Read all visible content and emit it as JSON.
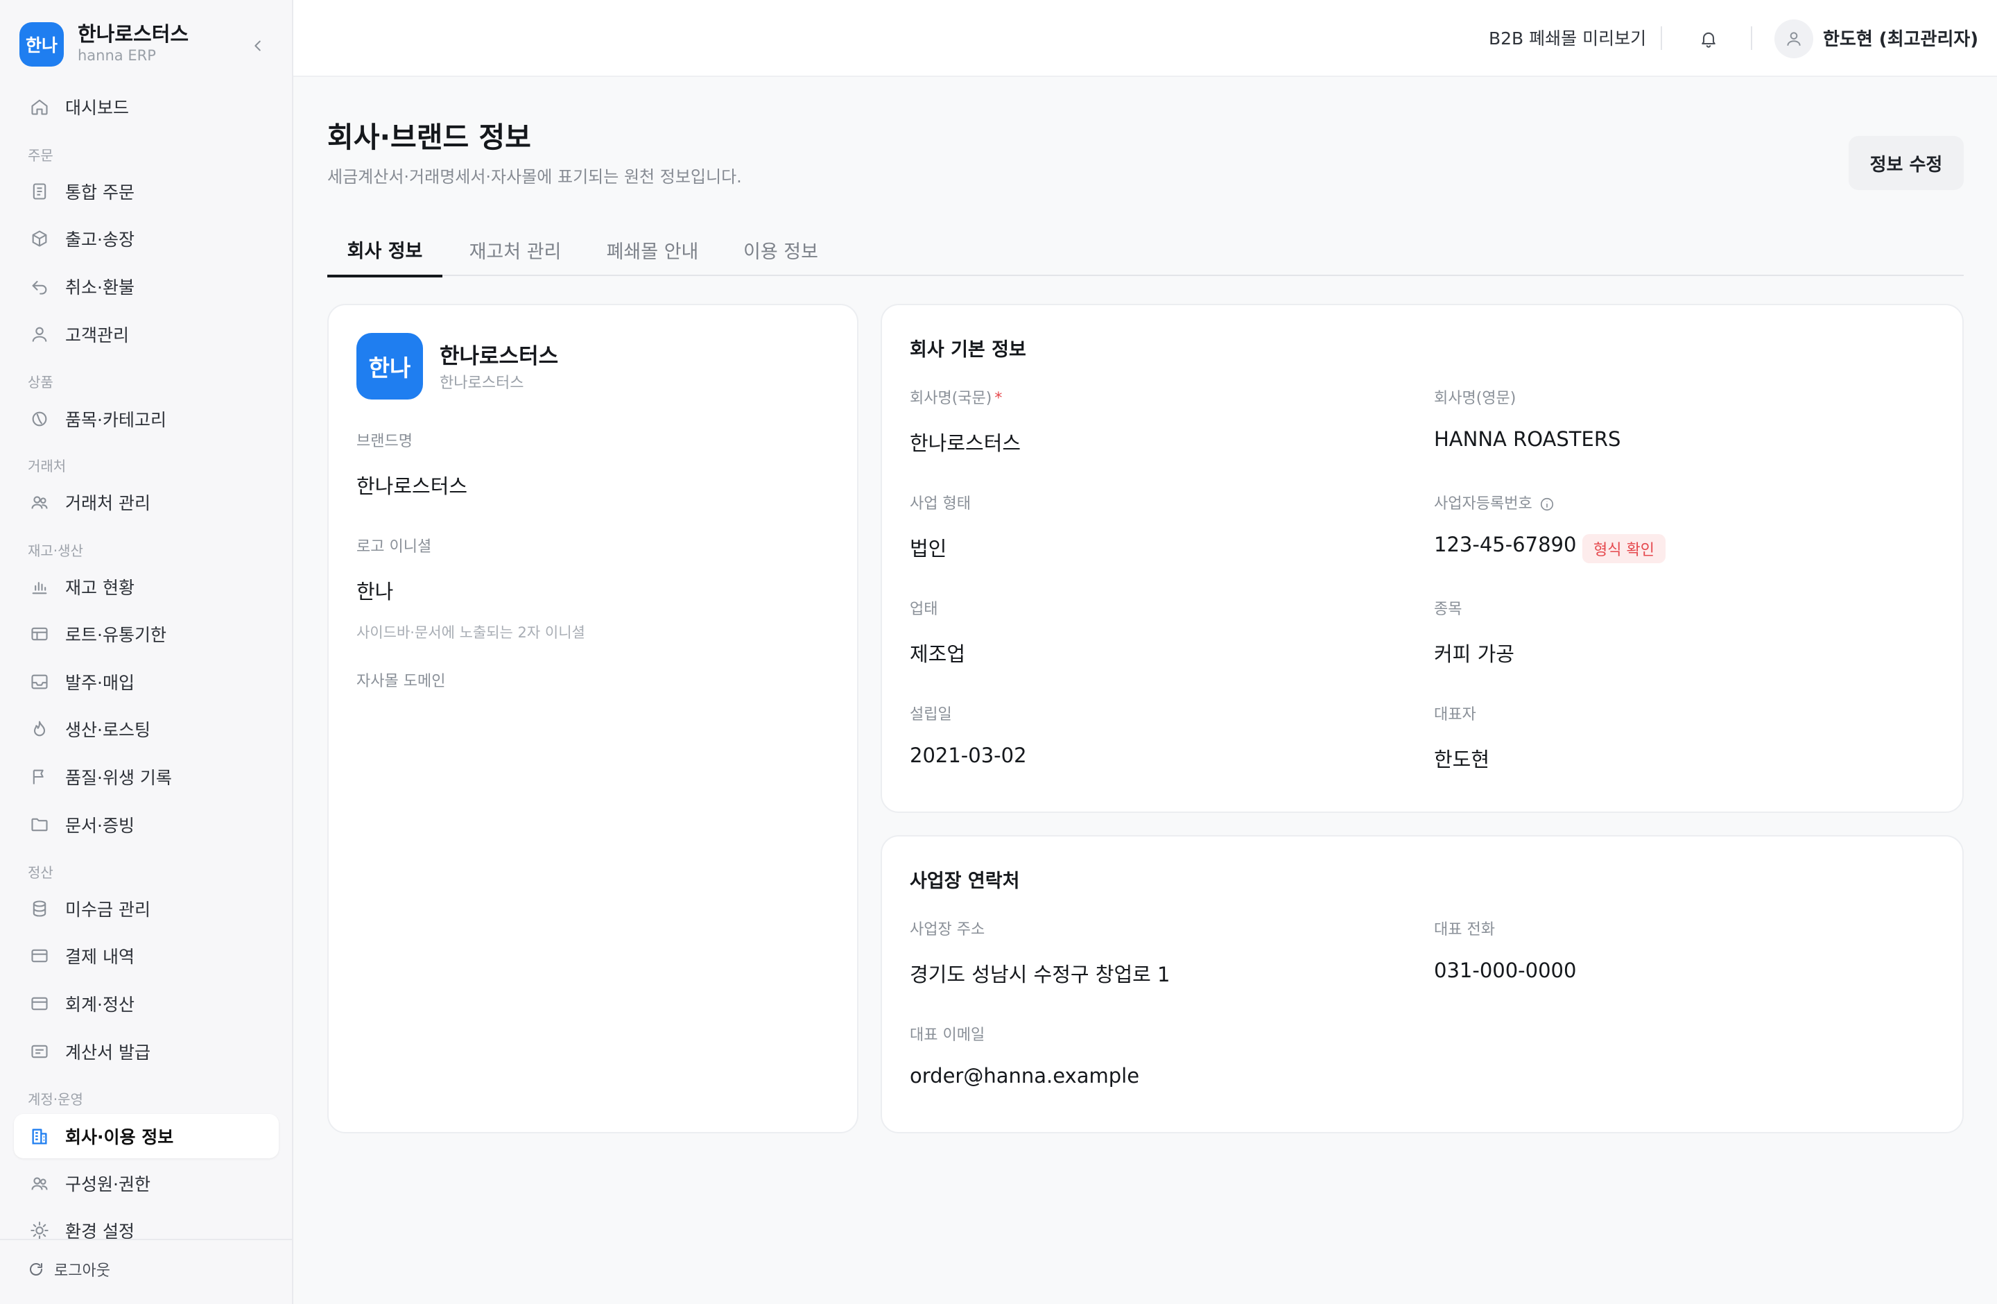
{
  "brand": {
    "logo_text": "한나",
    "name": "한나로스터스",
    "sub": "hanna ERP"
  },
  "nav": {
    "dashboard": "대시보드",
    "sec_order": "주문",
    "orders": "통합 주문",
    "shipping": "출고·송장",
    "refund": "취소·환불",
    "customers": "고객관리",
    "sec_product": "상품",
    "products": "품목·카테고리",
    "sec_partner": "거래처",
    "partners": "거래처 관리",
    "sec_inventory": "재고·생산",
    "stock": "재고 현황",
    "lots": "로트·유통기한",
    "purchase": "발주·매입",
    "roasting": "생산·로스팅",
    "quality": "품질·위생 기록",
    "documents": "문서·증빙",
    "sec_settle": "정산",
    "receivables": "미수금 관리",
    "payments": "결제 내역",
    "accounting": "회계·정산",
    "invoices": "계산서 발급",
    "sec_account": "계정·운영",
    "company": "회사·이용 정보",
    "members": "구성원·권한",
    "settings": "환경 설정",
    "logout": "로그아웃"
  },
  "topbar": {
    "preview_link": "B2B 폐쇄몰 미리보기",
    "user": "한도현 (최고관리자)"
  },
  "page": {
    "title": "회사·브랜드 정보",
    "subtitle": "세금계산서·거래명세서·자사몰에 표기되는 원천 정보입니다.",
    "edit_button": "정보 수정"
  },
  "tabs": [
    "회사 정보",
    "재고처 관리",
    "폐쇄몰 안내",
    "이용 정보"
  ],
  "brand_card": {
    "logo_text": "한나",
    "name": "한나로스터스",
    "sub": "한나로스터스",
    "brand_name_label": "브랜드명",
    "brand_name_value": "한나로스터스",
    "initial_label": "로고 이니셜",
    "initial_value": "한나",
    "initial_hint": "사이드바·문서에 노출되는 2자 이니셜",
    "domain_label": "자사몰 도메인"
  },
  "company_info": {
    "title": "회사 기본 정보",
    "name_ko_label": "회사명(국문)",
    "required_mark": "*",
    "name_ko": "한나로스터스",
    "name_en_label": "회사명(영문)",
    "name_en": "HANNA ROASTERS",
    "biz_type_label": "사업 형태",
    "biz_type": "법인",
    "reg_no_label": "사업자등록번호",
    "reg_no": "123-45-67890",
    "reg_badge": "형식 확인",
    "industry_label": "업태",
    "industry": "제조업",
    "item_label": "종목",
    "item": "커피 가공",
    "founded_label": "설립일",
    "founded": "2021-03-02",
    "ceo_label": "대표자",
    "ceo": "한도현"
  },
  "contact": {
    "title": "사업장 연락처",
    "address_label": "사업장 주소",
    "address": "경기도 성남시 수정구 창업로 1",
    "phone_label": "대표 전화",
    "phone": "031-000-0000",
    "email_label": "대표 이메일",
    "email": "order@hanna.example"
  },
  "colors": {
    "accent": "#1f7ef0",
    "danger": "#e5484d",
    "badge_bg": "#fdecec"
  }
}
